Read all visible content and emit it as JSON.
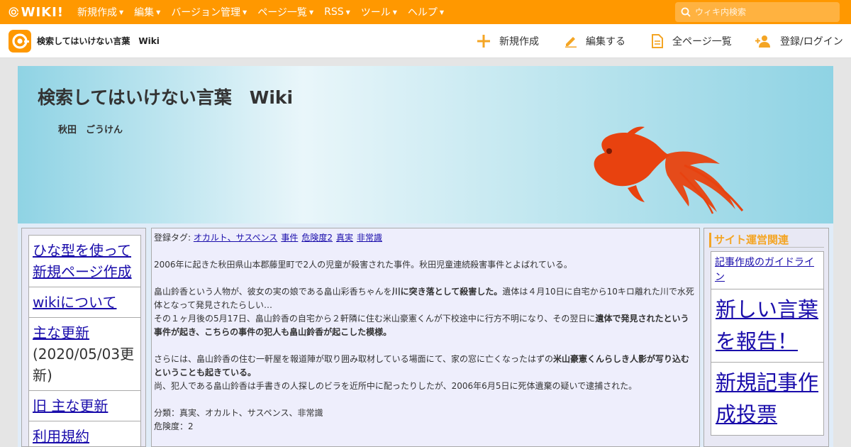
{
  "topbar": {
    "logo_text": "WIKI!",
    "menu": [
      "新規作成",
      "編集",
      "バージョン管理",
      "ページ一覧",
      "RSS",
      "ツール",
      "ヘルプ"
    ],
    "search_placeholder": "ウィキ内検索"
  },
  "subbar": {
    "site_name": "検索してはいけない言葉　Wiki",
    "actions": {
      "create": "新規作成",
      "edit": "編集する",
      "all_pages": "全ページ一覧",
      "login": "登録/ログイン"
    }
  },
  "banner": {
    "title": "検索してはいけない言葉　Wiki",
    "author": "秋田　ごうけん"
  },
  "left_nav": {
    "item1": "ひな型を使って新規ページ作成",
    "item2": "wikiについて",
    "item3_link": "主な更新",
    "item3_sub": "(2020/05/03更新)",
    "item4": "旧 主な更新",
    "item5": "利用規約"
  },
  "content": {
    "tags_label": "登録タグ: ",
    "tags": [
      "オカルト、サスペンス",
      "事件",
      "危険度2",
      "真実",
      "非常識"
    ],
    "p1": "2006年に起きた秋田県山本郡藤里町で2人の児童が殺害された事件。秋田児童連続殺害事件とよばれている。",
    "p2a": "畠山鈴香という人物が、彼女の実の娘である畠山彩香ちゃんを",
    "p2b": "川に突き落として殺害した。",
    "p2c": "遺体は４月10日に自宅から10キロ離れた川で水死体となって発見されたらしい…",
    "p3a": "その１ヶ月後の5月17日、畠山鈴香の自宅から２軒隣に住む米山豪憲くんが下校途中に行方不明になり、その翌日に",
    "p3b": "遺体で発見されたという事件が起き、こちらの事件の犯人も畠山鈴香が起こした模様。",
    "p4a": "さらには、畠山鈴香の住む一軒屋を報道陣が取り囲み取材している場面にて、家の窓に亡くなったはずの",
    "p4b": "米山豪憲くんらしき人影が写り込むということも起きている。",
    "p5": "尚、犯人である畠山鈴香は手書きの人探しのビラを近所中に配ったりしたが、2006年6月5日に死体遺棄の疑いで逮捕された。",
    "category": "分類：真実、オカルト、サスペンス、非常識",
    "danger": "危険度：2"
  },
  "right_panel": {
    "heading": "サイト運営関連",
    "link1": "記事作成のガイドライン",
    "link2": "新しい言葉を報告！",
    "link3": "新規記事作成投票"
  },
  "colors": {
    "topbar": "#ff9800",
    "accent": "#f4a524",
    "fish": "#e8420f",
    "link": "#1a0dab"
  }
}
